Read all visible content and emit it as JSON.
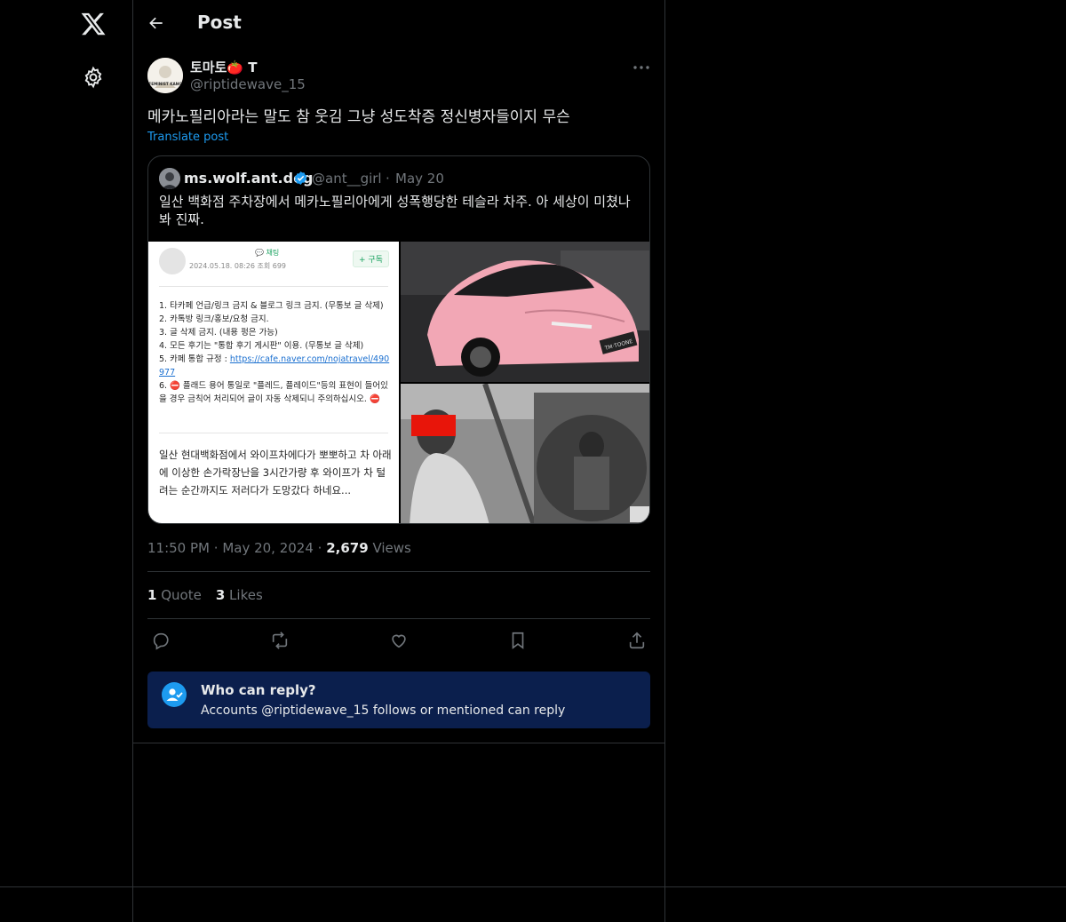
{
  "header": {
    "title": "Post"
  },
  "post": {
    "author_name": "토마토🍅 T",
    "author_handle": "@riptidewave_15",
    "avatar_text": "FEMINIST KANG",
    "text": "메카노필리아라는 말도 참 웃김 그냥 성도착증 정신병자들이지 무슨",
    "translate_label": "Translate post",
    "time": "11:50 PM",
    "date": "May 20, 2024",
    "views_count": "2,679",
    "views_label": "Views",
    "quotes_count": "1",
    "quotes_label": "Quote",
    "likes_count": "3",
    "likes_label": "Likes"
  },
  "quote": {
    "name": "ms.wolf.ant.dog",
    "handle": "@ant__girl",
    "date": "May 20",
    "text": "일산 백화점 주차장에서 메카노필리아에게 성폭행당한 테슬라 차주. 아 세상이 미쳤나봐 진짜.",
    "screenshot": {
      "date": "2024.05.18. 08:26  조회 699",
      "chat": "채팅",
      "subscribe": "+ 구독",
      "rules": [
        "1. 타카페 언급/링크 금지 & 블로그 링크 금지. (무통보 글 삭제)",
        "2. 카톡방 링크/홍보/요청 금지.",
        "3. 글 삭제 금지. (내용 펑은 가능)",
        "4. 모든 후기는 \"통합 후기 게시판\" 이용. (무통보 글 삭제)",
        "5. 카페 통합 규정 :",
        "https://cafe.naver.com/nojatravel/490977",
        "6. ⛔ 플래드 용어 통일로 \"플레드, 플레이드\"등의 표현이 들어있을 경우 금칙어 처리되어 글이 자동 삭제되니 주의하십시오. ⛔"
      ],
      "body": "일산 현대백화점에서 와이프차에다가 뽀뽀하고 차 아래에 이상한 손가락장난을 3시간가량 후 와이프가 차 털려는 순간까지도 저러다가 도망갔다 하네요..."
    },
    "plate_text": "TM·TOONE"
  },
  "reply": {
    "title": "Who can reply?",
    "subtitle": "Accounts @riptidewave_15 follows or mentioned can reply"
  },
  "icons": {
    "logo": "x-logo-icon",
    "settings": "gear-icon",
    "back": "arrow-left-icon",
    "more": "more-horizontal-icon",
    "verified": "verified-badge-icon",
    "reply": "reply-icon",
    "repost": "repost-icon",
    "like": "heart-icon",
    "bookmark": "bookmark-icon",
    "share": "share-icon",
    "who_can_reply": "at-person-icon"
  },
  "colors": {
    "background": "#000000",
    "border": "#2f3336",
    "text_primary": "#e7e9ea",
    "text_secondary": "#71767b",
    "accent": "#1d9bf0",
    "reply_box": "#0b1f4d"
  }
}
